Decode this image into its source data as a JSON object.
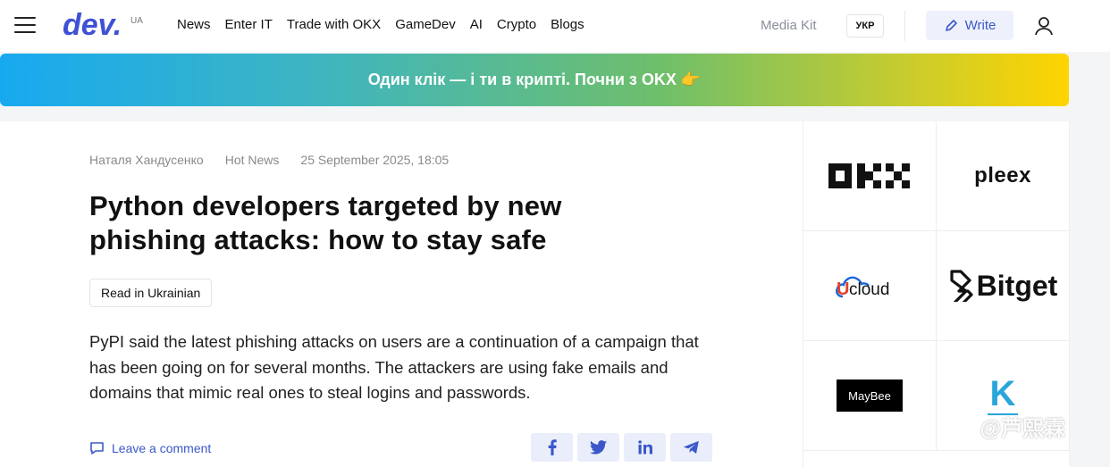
{
  "header": {
    "logo_suffix": "UA",
    "nav": [
      "News",
      "Enter IT",
      "Trade with OKX",
      "GameDev",
      "AI",
      "Crypto",
      "Blogs"
    ],
    "media_kit": "Media Kit",
    "lang": "УКР",
    "write_label": "Write"
  },
  "banner": {
    "text": "Один клік — і ти в крипті. Почни з OKX 👉"
  },
  "article": {
    "author": "Наталя Хандусенко",
    "category": "Hot News",
    "date": "25 September 2025, 18:05",
    "title": "Python developers targeted by new phishing attacks: how to stay safe",
    "read_in_label": "Read in Ukrainian",
    "lead": "PyPI said the latest phishing attacks on users are a continuation of a campaign that has been going on for several months. The attackers are using fake emails and domains that mimic real ones to steal logins and passwords.",
    "comment_label": "Leave a comment",
    "share_icons": [
      "facebook-icon",
      "twitter-icon",
      "linkedin-icon",
      "telegram-icon"
    ]
  },
  "partners": {
    "logos": [
      "OKX",
      "pleex",
      "Ucloud",
      "Bitget",
      "MayBee",
      "K"
    ]
  },
  "watermark": {
    "text": "@芦熙霖"
  },
  "colors": {
    "accent": "#3b58c9",
    "banner_start": "#17a9f0",
    "banner_end": "#ffd400"
  }
}
